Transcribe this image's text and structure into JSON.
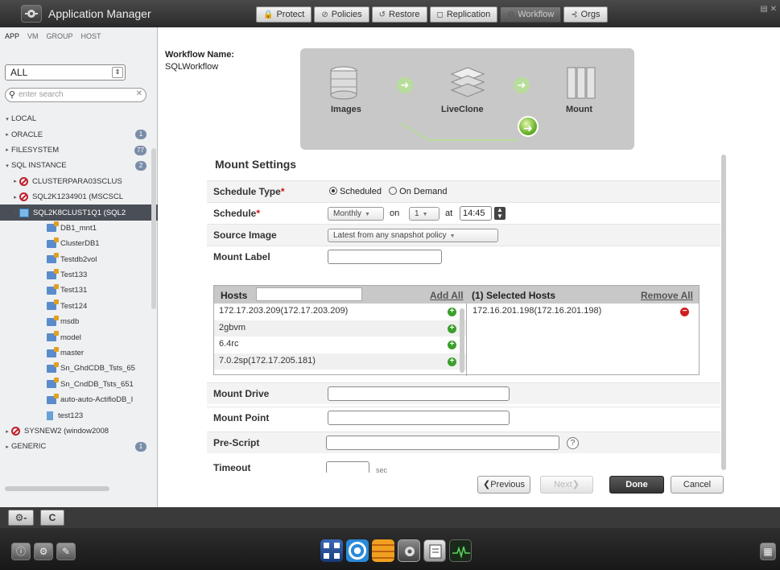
{
  "app": {
    "title": "Application Manager"
  },
  "top_nav": [
    {
      "label": "Protect",
      "icon": "lock-icon",
      "glyph": "🔒"
    },
    {
      "label": "Policies",
      "icon": "circle-icon",
      "glyph": "⊘"
    },
    {
      "label": "Restore",
      "icon": "restore-icon",
      "glyph": "↺"
    },
    {
      "label": "Replication",
      "icon": "replication-icon",
      "glyph": "◻"
    },
    {
      "label": "Workflow",
      "icon": "workflow-icon",
      "glyph": "⚙",
      "active": true
    },
    {
      "label": "Orgs",
      "icon": "orgs-icon",
      "glyph": "⊰"
    }
  ],
  "sidebar": {
    "tabs": [
      "APP",
      "VM",
      "GROUP",
      "HOST"
    ],
    "scope": "ALL",
    "search_placeholder": "enter search",
    "tree": [
      {
        "label": "LOCAL",
        "twisty": "▾",
        "indent": 4
      },
      {
        "label": "ORACLE",
        "twisty": "▸",
        "indent": 4,
        "badge": "1"
      },
      {
        "label": "FILESYSTEM",
        "twisty": "▸",
        "indent": 4,
        "badge": "77"
      },
      {
        "label": "SQL INSTANCE",
        "twisty": "▾",
        "indent": 4,
        "badge": "2"
      },
      {
        "label": "CLUSTERPARA03SCLUS",
        "twisty": "▸",
        "indent": 14,
        "icon": "no"
      },
      {
        "label": "SQL2K1234901 (MSCSCL",
        "twisty": "▸",
        "indent": 14,
        "icon": "no"
      },
      {
        "label": "SQL2K8CLUST1Q1 (SQL2",
        "twisty": "▾",
        "indent": 14,
        "icon": "srv",
        "selected": true
      },
      {
        "label": "DB1_mnt1",
        "indent": 58,
        "icon": "db"
      },
      {
        "label": "ClusterDB1",
        "indent": 58,
        "icon": "db"
      },
      {
        "label": "Testdb2vol",
        "indent": 58,
        "icon": "db"
      },
      {
        "label": "Test133",
        "indent": 58,
        "icon": "db"
      },
      {
        "label": "Test131",
        "indent": 58,
        "icon": "db"
      },
      {
        "label": "Test124",
        "indent": 58,
        "icon": "db"
      },
      {
        "label": "msdb",
        "indent": 58,
        "icon": "db"
      },
      {
        "label": "model",
        "indent": 58,
        "icon": "db"
      },
      {
        "label": "master",
        "indent": 58,
        "icon": "db"
      },
      {
        "label": "Sn_GhdCDB_Tsts_65",
        "indent": 58,
        "icon": "db"
      },
      {
        "label": "Sn_CndDB_Tsts_651",
        "indent": 58,
        "icon": "db"
      },
      {
        "label": "auto-auto-ActifioDB_I",
        "indent": 58,
        "icon": "db"
      },
      {
        "label": "test123",
        "indent": 58,
        "icon": "vol"
      },
      {
        "label": "SYSNEW2 (window2008",
        "twisty": "▸",
        "indent": 4,
        "icon": "no"
      },
      {
        "label": "GENERIC",
        "twisty": "▸",
        "indent": 4,
        "badge": "1"
      }
    ]
  },
  "workflow": {
    "name_label": "Workflow Name:",
    "name_value": "SQLWorkflow",
    "stages": [
      "Images",
      "LiveClone",
      "Mount"
    ]
  },
  "mount_settings": {
    "title": "Mount Settings",
    "schedule_type_label": "Schedule Type",
    "schedule_type_options": [
      "Scheduled",
      "On Demand"
    ],
    "schedule_type_selected": "Scheduled",
    "schedule_label": "Schedule",
    "schedule_frequency": "Monthly",
    "on_text": "on",
    "schedule_day": "1",
    "at_text": "at",
    "schedule_time": "14:45",
    "source_image_label": "Source Image",
    "source_image_value": "Latest from any snapshot policy",
    "mount_label_label": "Mount Label",
    "mount_label_value": "",
    "hosts_label": "Hosts",
    "add_all_label": "Add All",
    "selected_hosts_label": "(1) Selected Hosts",
    "remove_all_label": "Remove All",
    "available_hosts": [
      "172.17.203.209(172.17.203.209)",
      "2gbvm",
      "6.4rc",
      "7.0.2sp(172.17.205.181)"
    ],
    "selected_hosts": [
      "172.16.201.198(172.16.201.198)"
    ],
    "mount_drive_label": "Mount Drive",
    "mount_point_label": "Mount Point",
    "pre_script_label": "Pre-Script",
    "timeout_label": "Timeout",
    "timeout_unit": "sec"
  },
  "buttons": {
    "previous": "❮Previous",
    "next": "Next❯",
    "done": "Done",
    "cancel": "Cancel"
  },
  "bottom_toolbar": {
    "gear_label": "⚙-",
    "c_label": "C"
  }
}
